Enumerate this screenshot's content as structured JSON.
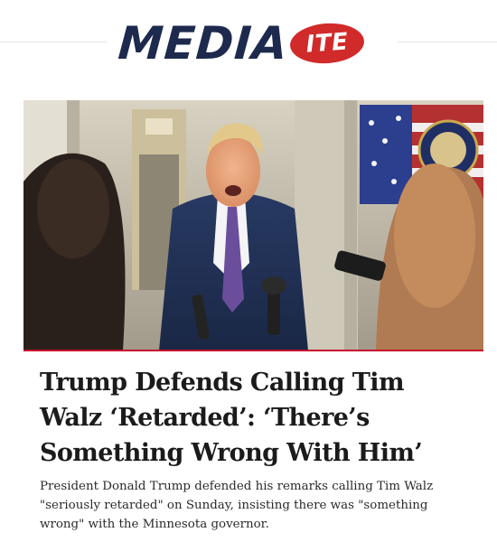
{
  "site": {
    "logo_text": "MEDIA",
    "logo_badge": "ITE",
    "brand_colors": {
      "navy": "#1d2a4d",
      "red": "#d12a2a"
    }
  },
  "article": {
    "image_alt": "Donald Trump speaking to reporters aboard a plane",
    "headline": "Trump Defends Calling Tim Walz ‘Retarded’: ‘There’s Something Wrong With Him’",
    "summary": "President Donald Trump defended his remarks calling Tim Walz \"seriously retarded\" on Sunday, insisting there was \"something wrong\" with the Minnesota governor."
  }
}
